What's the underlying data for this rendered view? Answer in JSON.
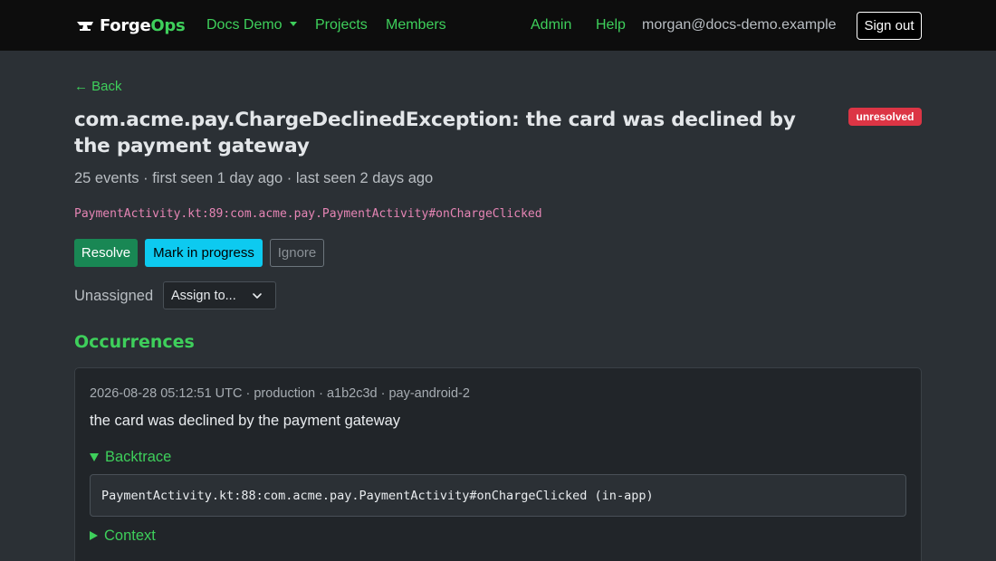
{
  "nav": {
    "brand_main": "Forge",
    "brand_accent": "Ops",
    "project_dropdown": "Docs Demo",
    "projects": "Projects",
    "members": "Members",
    "admin": "Admin",
    "help": "Help",
    "user_email": "morgan@docs-demo.example",
    "sign_out": "Sign out"
  },
  "issue": {
    "back": "← Back",
    "title": "com.acme.pay.ChargeDeclinedException: the card was declined by the payment gateway",
    "status": "unresolved",
    "status_color": "#dc3545",
    "meta": "25 events · first seen 1 day ago · last seen 2 days ago",
    "location": "PaymentActivity.kt:89:com.acme.pay.PaymentActivity#onChargeClicked"
  },
  "actions": {
    "resolve": "Resolve",
    "in_progress": "Mark in progress",
    "ignore": "Ignore"
  },
  "assignment": {
    "label": "Unassigned",
    "select_value": "Assign to..."
  },
  "occurrences": {
    "heading": "Occurrences",
    "items": [
      {
        "meta": "2026-08-28 05:12:51 UTC · production · a1b2c3d · pay-android-2",
        "message": "the card was declined by the payment gateway",
        "backtrace_label": "Backtrace",
        "backtrace_line": "PaymentActivity.kt:88:com.acme.pay.PaymentActivity#onChargeClicked (in-app)",
        "context_label": "Context"
      }
    ]
  },
  "colors": {
    "accent": "#3ecf5b",
    "background": "#2b3035",
    "navbar": "#0d0d0d",
    "success": "#198754",
    "info": "#0dcaf0",
    "danger": "#dc3545",
    "code": "#e685b5"
  }
}
